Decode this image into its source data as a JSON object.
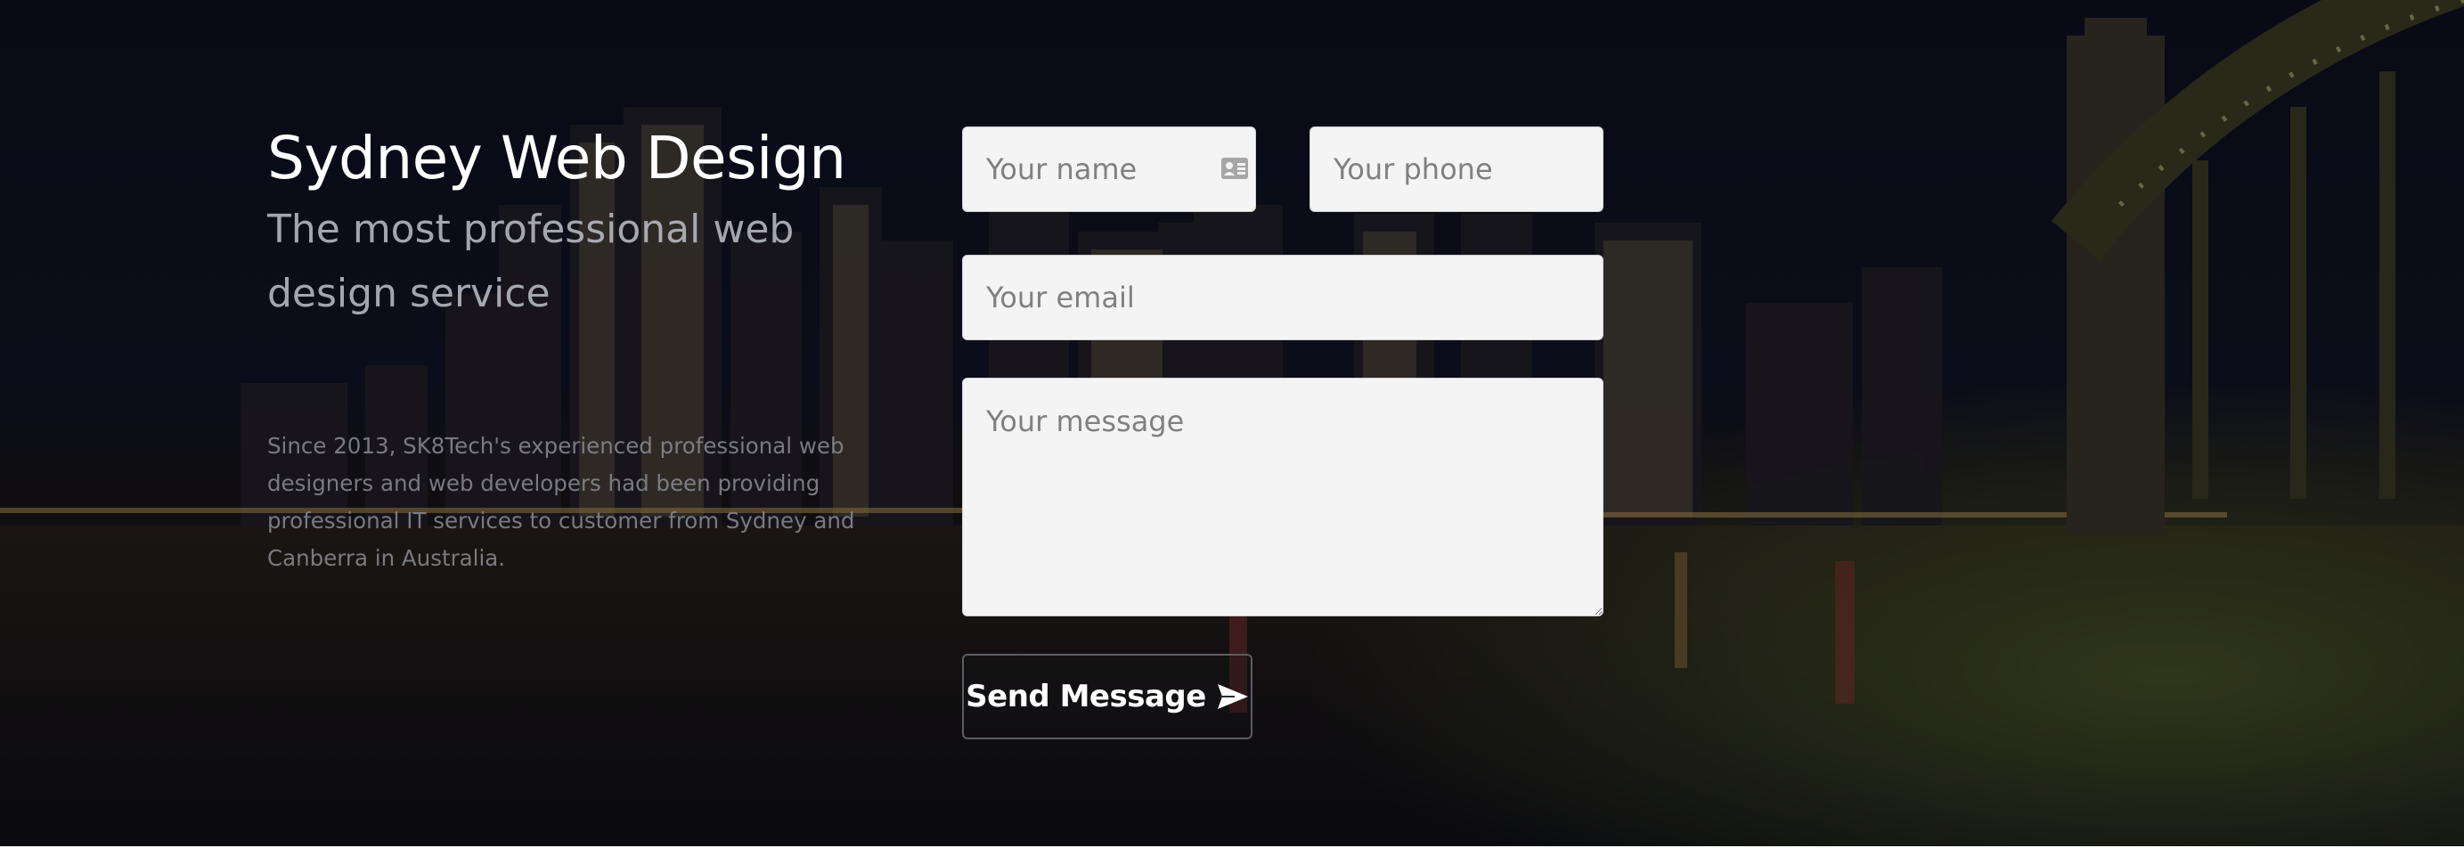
{
  "hero": {
    "title": "Sydney Web Design",
    "subtitle": "The most professional web design service",
    "body": "Since 2013, SK8Tech's experienced professional web designers and web developers had been providing professional IT services to customer from Sydney and Canberra in Australia."
  },
  "form": {
    "name_placeholder": "Your name",
    "phone_placeholder": "Your phone",
    "email_placeholder": "Your email",
    "message_placeholder": "Your message",
    "submit_label": "Send Message",
    "name_icon": "id-card-icon",
    "submit_icon": "paper-plane-icon"
  },
  "colors": {
    "field_background": "#f4f4f4",
    "button_border": "#5a5d63",
    "title_text": "#ffffff"
  }
}
